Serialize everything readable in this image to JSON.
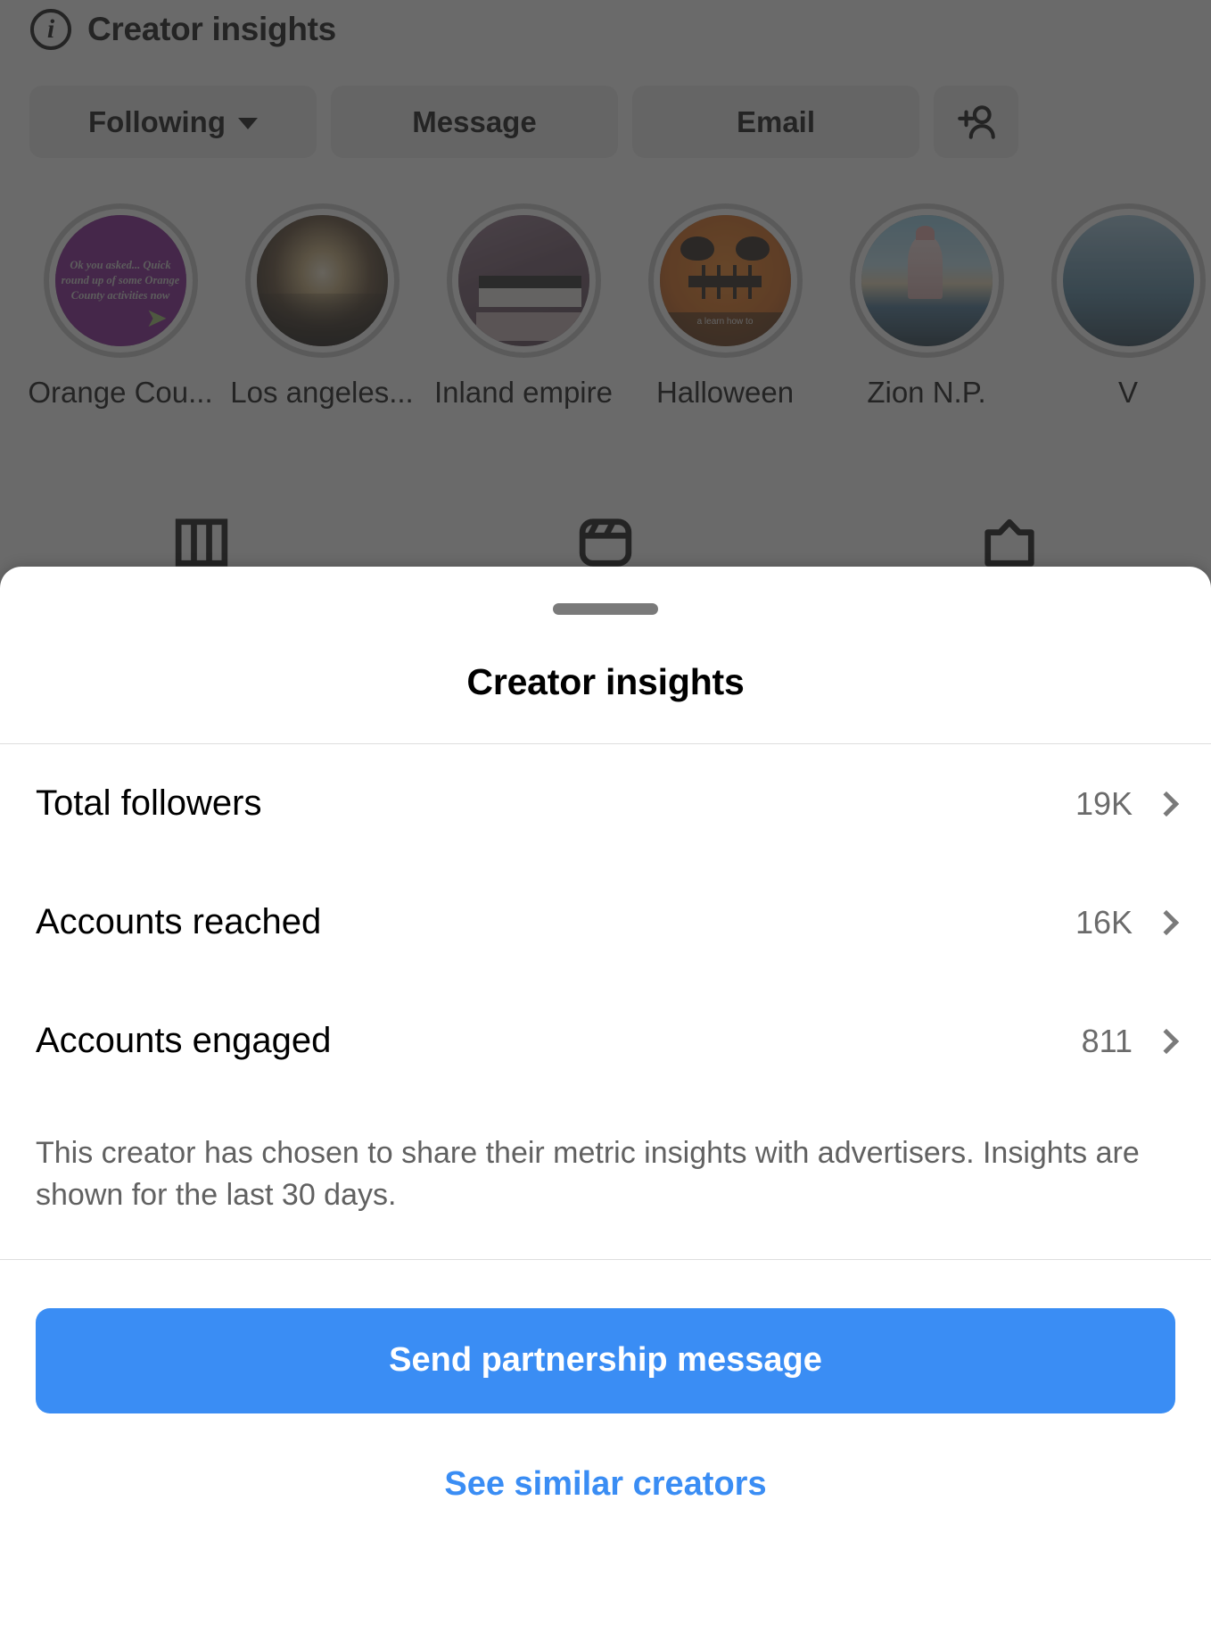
{
  "background": {
    "insights_header": {
      "icon": "info-circle-icon",
      "title": "Creator insights"
    },
    "actions": [
      {
        "label": "Following",
        "icon": "chevron-down-icon"
      },
      {
        "label": "Message",
        "icon": ""
      },
      {
        "label": "Email",
        "icon": ""
      },
      {
        "label": "",
        "icon": "add-person-icon"
      }
    ],
    "highlights": [
      {
        "label": "Orange Cou...",
        "art": "purple-text",
        "art_text": "Ok you asked... Quick round up of some Orange County activities now"
      },
      {
        "label": "Los angeles...",
        "art": "union-station"
      },
      {
        "label": "Inland empire",
        "art": "dm-screenshot"
      },
      {
        "label": "Halloween",
        "art": "pumpkin",
        "art_caption": "a learn how to"
      },
      {
        "label": "Zion N.P.",
        "art": "zion"
      },
      {
        "label": "V",
        "art": "partial"
      }
    ],
    "tabs": [
      {
        "icon": "grid-icon"
      },
      {
        "icon": "reels-icon"
      },
      {
        "icon": "tagged-icon"
      }
    ]
  },
  "sheet": {
    "grabber": "drag-handle",
    "title": "Creator insights",
    "metrics": [
      {
        "label": "Total followers",
        "value": "19K",
        "chevron": "chevron-right-icon"
      },
      {
        "label": "Accounts reached",
        "value": "16K",
        "chevron": "chevron-right-icon"
      },
      {
        "label": "Accounts engaged",
        "value": "811",
        "chevron": "chevron-right-icon"
      }
    ],
    "disclaimer": "This creator has chosen to share their metric insights with advertisers. Insights are shown for the last 30 days.",
    "primary_cta": "Send partnership message",
    "secondary_cta": "See similar creators",
    "accent_color": "#3a8df4"
  }
}
